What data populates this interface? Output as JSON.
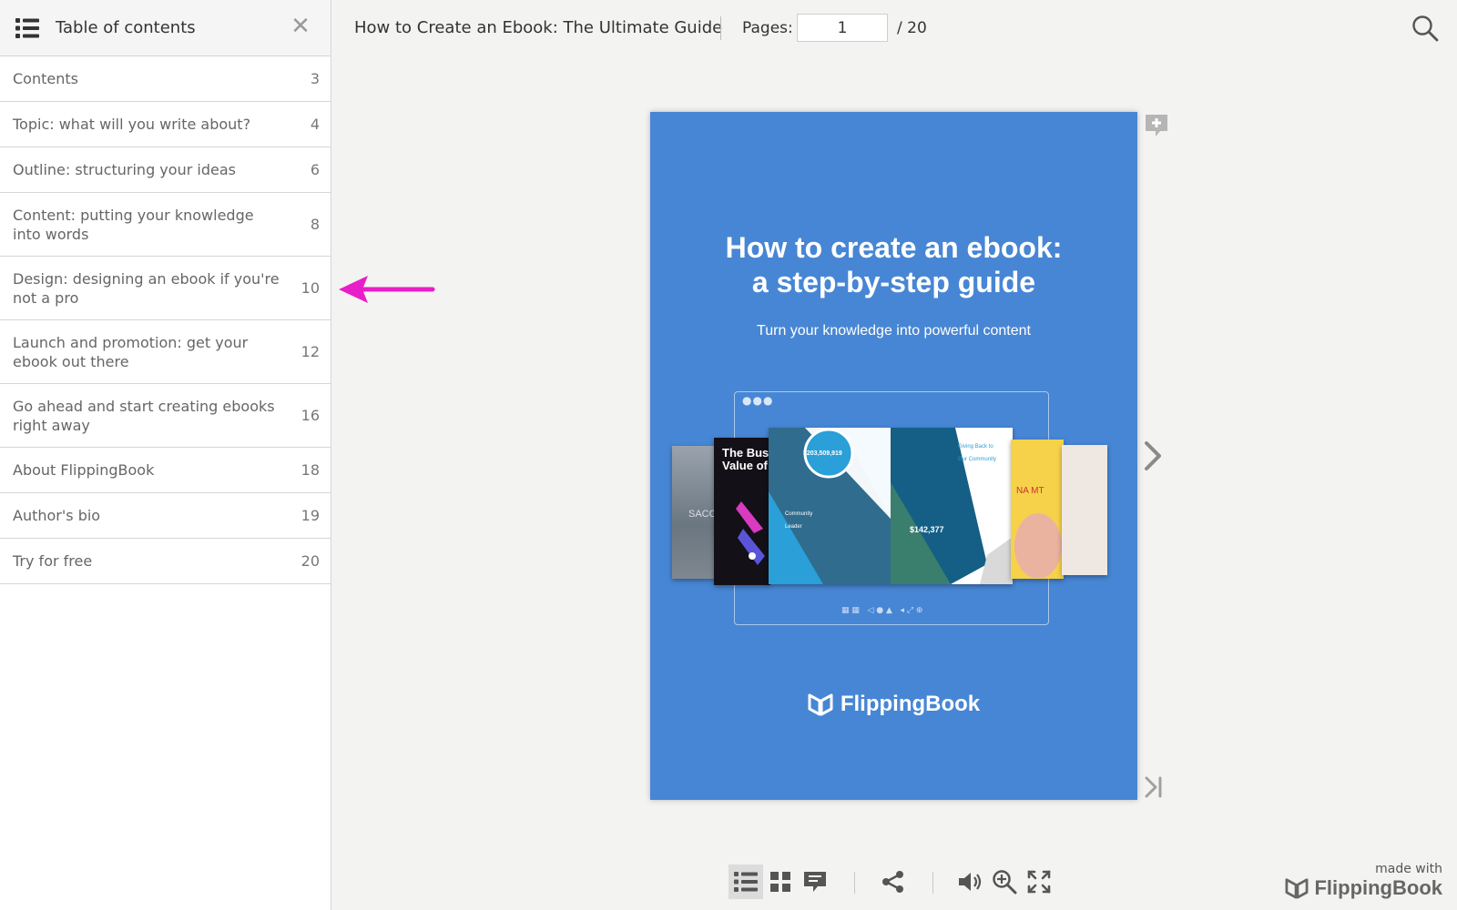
{
  "sidebar": {
    "title": "Table of contents",
    "items": [
      {
        "label": "Contents",
        "page": "3"
      },
      {
        "label": "Topic: what will you write about?",
        "page": "4"
      },
      {
        "label": "Outline: structuring your ideas",
        "page": "6"
      },
      {
        "label": "Content: putting your knowledge into words",
        "page": "8"
      },
      {
        "label": "Design: designing an ebook if you're not a pro",
        "page": "10"
      },
      {
        "label": "Launch and promotion: get your ebook out there",
        "page": "12"
      },
      {
        "label": "Go ahead and start creating ebooks right away",
        "page": "16"
      },
      {
        "label": "About FlippingBook",
        "page": "18"
      },
      {
        "label": "Author's bio",
        "page": "19"
      },
      {
        "label": "Try for free",
        "page": "20"
      }
    ]
  },
  "topbar": {
    "doc_title": "How to Create an Ebook: The Ultimate Guide",
    "pages_label": "Pages:",
    "current_page": "1",
    "total_pages": "/  20"
  },
  "cover": {
    "title_line1": "How to create an ebook:",
    "title_line2": "a step-by-step guide",
    "subtitle": "Turn your knowledge into powerful content",
    "brand": "FlippingBook",
    "thumb_text_1": "The Bus",
    "thumb_text_2": "Value of",
    "thumb_amount": "$203,509,919",
    "thumb_amount_2": "$142,377",
    "thumb_text_3": "Community Leader",
    "thumb_text_4": "Giving Back to Our Community",
    "thumb_text_5": "SACC",
    "thumb_text_6": "NA MT"
  },
  "footer": {
    "made_with": "made with",
    "brand": "FlippingBook"
  },
  "colors": {
    "cover_blue": "#4786d4",
    "annotation_arrow": "#e81ec8"
  }
}
